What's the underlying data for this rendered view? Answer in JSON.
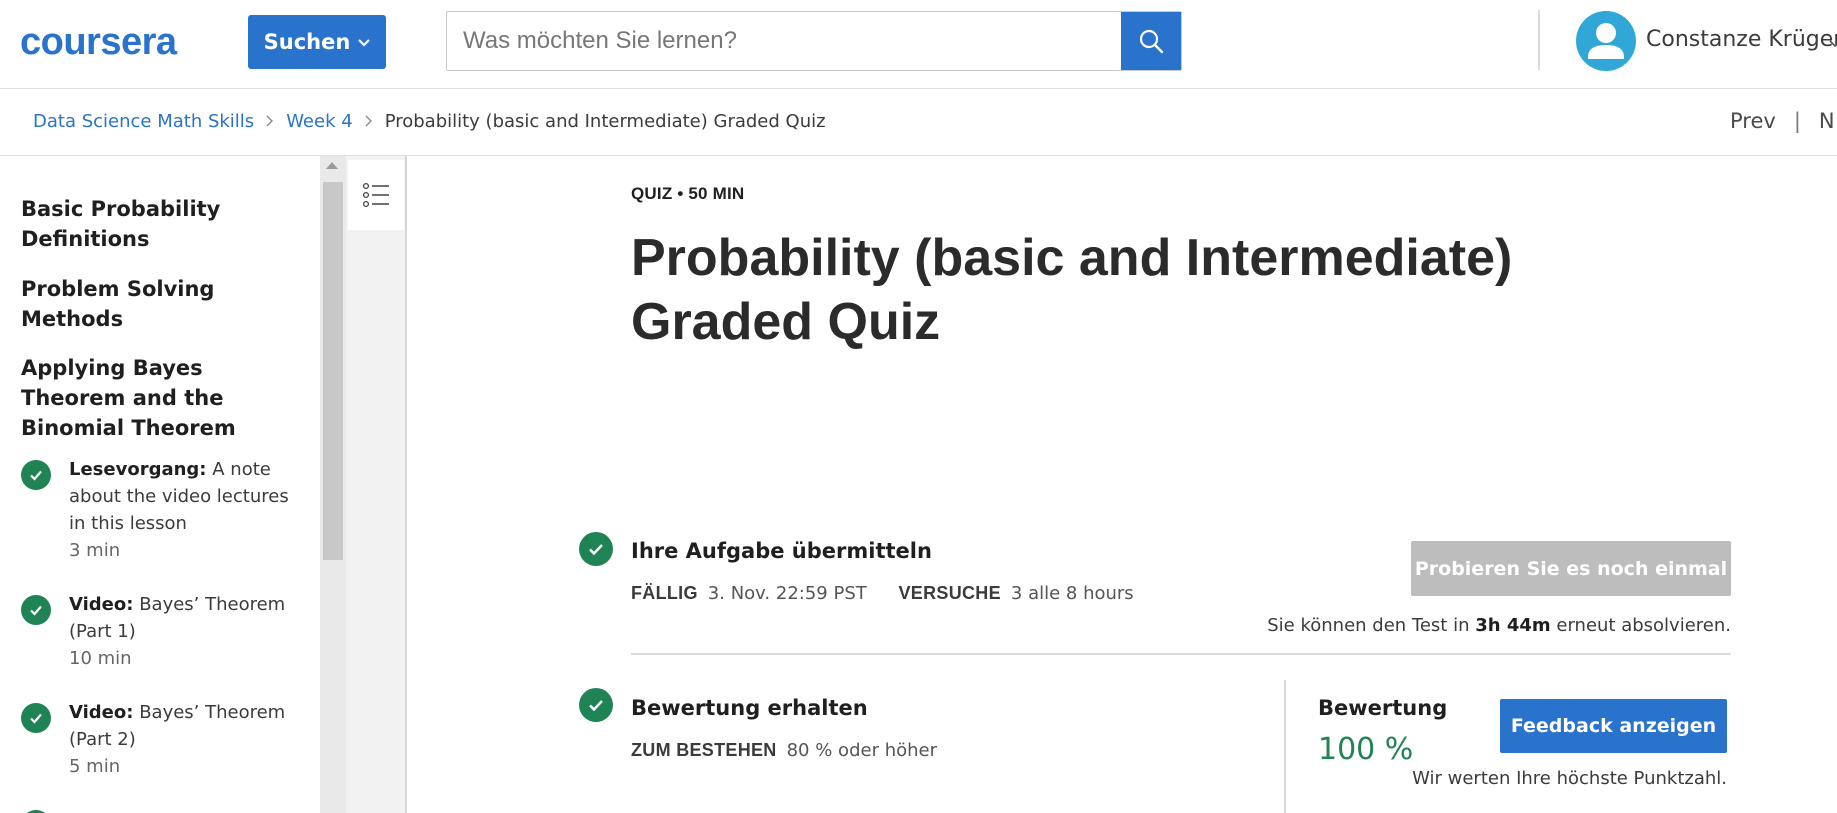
{
  "header": {
    "logo_text": "coursera",
    "logo_color": "#2a73cc",
    "search_dropdown_label": "Suchen",
    "search_placeholder": "Was möchten Sie lernen?",
    "search_value": "",
    "user_name": "Constanze Krüger",
    "accent_color": "#2a73cc"
  },
  "breadcrumb": {
    "items": [
      "Data Science Math Skills",
      "Week 4"
    ],
    "current": "Probability (basic and Intermediate) Graded Quiz",
    "prev_label": "Prev",
    "separator": "|",
    "next_label": "N"
  },
  "sidebar": {
    "sections": [
      "Basic Probability Definitions",
      "Problem Solving Methods",
      "Applying Bayes Theorem and the Binomial Theorem"
    ],
    "items": [
      {
        "type": "Lesevorgang:",
        "title": "A note about the video lectures in this lesson",
        "duration": "3 min",
        "status": "completed"
      },
      {
        "type": "Video:",
        "title": "Bayes’ Theorem (Part 1)",
        "duration": "10 min",
        "status": "completed"
      },
      {
        "type": "Video:",
        "title": "Bayes’ Theorem (Part 2)",
        "duration": "5 min",
        "status": "completed"
      }
    ]
  },
  "main": {
    "eyebrow": "QUIZ • 50 MIN",
    "title": "Probability (basic and Intermediate) Graded Quiz",
    "submit": {
      "title": "Ihre Aufgabe übermitteln",
      "due_label": "FÄLLIG",
      "due_value": "3. Nov. 22:59 PST",
      "attempts_label": "VERSUCHE",
      "attempts_value": "3 alle 8 hours",
      "retry_button": "Probieren Sie es noch einmal",
      "retry_note_prefix": "Sie können den Test in",
      "retry_note_time": "3h 44m",
      "retry_note_suffix": "erneut absolvieren."
    },
    "grade": {
      "title": "Bewertung erhalten",
      "pass_label": "ZUM BESTEHEN",
      "pass_value": "80 % oder höher",
      "grade_label": "Bewertung",
      "grade_value": "100 %",
      "feedback_button": "Feedback anzeigen",
      "note": "Wir werten Ihre höchste Punktzahl."
    },
    "success_color": "#1f8354"
  }
}
